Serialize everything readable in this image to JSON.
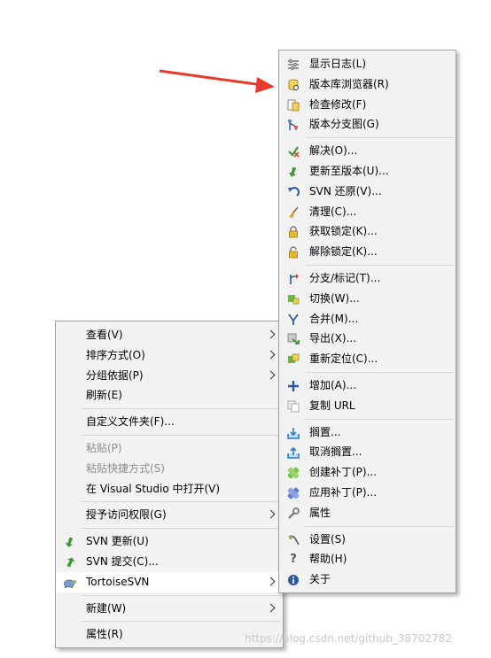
{
  "context_menu": {
    "view": "查看(V)",
    "sort": "排序方式(O)",
    "group": "分组依据(P)",
    "refresh": "刷新(E)",
    "customize": "自定义文件夹(F)...",
    "paste": "粘贴(P)",
    "paste_shortcut": "粘贴快捷方式(S)",
    "open_vs": "在 Visual Studio 中打开(V)",
    "give_access": "授予访问权限(G)",
    "svn_update": "SVN 更新(U)",
    "svn_commit": "SVN 提交(C)...",
    "tortoisesvn": "TortoiseSVN",
    "new": "新建(W)",
    "properties": "属性(R)"
  },
  "svn_submenu": {
    "show_log": "显示日志(L)",
    "repo_browser": "版本库浏览器(R)",
    "check_mods": "检查修改(F)",
    "revision_graph": "版本分支图(G)",
    "resolve": "解决(O)...",
    "update_to_rev": "更新至版本(U)...",
    "revert": "SVN 还原(V)...",
    "cleanup": "清理(C)...",
    "get_lock": "获取锁定(K)...",
    "release_lock": "解除锁定(K)...",
    "branch_tag": "分支/标记(T)...",
    "switch": "切换(W)...",
    "merge": "合并(M)...",
    "export": "导出(X)...",
    "relocate": "重新定位(C)...",
    "add": "增加(A)...",
    "copy_url": "复制 URL",
    "shelve": "搁置...",
    "unshelve": "取消搁置...",
    "create_patch": "创建补丁(P)...",
    "apply_patch": "应用补丁(P)...",
    "properties": "属性",
    "settings": "设置(S)",
    "help": "帮助(H)",
    "about": "关于"
  },
  "watermark": "https://blog.csdn.net/github_38702782",
  "colors": {
    "menu_bg": "#f2f2f2",
    "border": "#a0a0a0",
    "disabled_text": "#8d8d8d",
    "annotation_arrow": "#e8392b"
  },
  "icons": {
    "show_log": "log-icon",
    "repo_browser": "repo-browser-icon",
    "check_mods": "check-modifications-icon",
    "revision_graph": "revision-graph-icon",
    "resolve": "resolve-icon",
    "update_to_rev": "update-icon",
    "revert": "revert-icon",
    "cleanup": "cleanup-icon",
    "get_lock": "lock-icon",
    "release_lock": "unlock-icon",
    "branch_tag": "branch-icon",
    "switch": "switch-icon",
    "merge": "merge-icon",
    "export": "export-icon",
    "relocate": "relocate-icon",
    "add": "add-icon",
    "copy_url": "copy-url-icon",
    "shelve": "shelve-icon",
    "unshelve": "unshelve-icon",
    "create_patch": "create-patch-icon",
    "apply_patch": "apply-patch-icon",
    "properties": "wrench-icon",
    "settings": "settings-icon",
    "help": "help-icon",
    "about": "info-icon"
  }
}
